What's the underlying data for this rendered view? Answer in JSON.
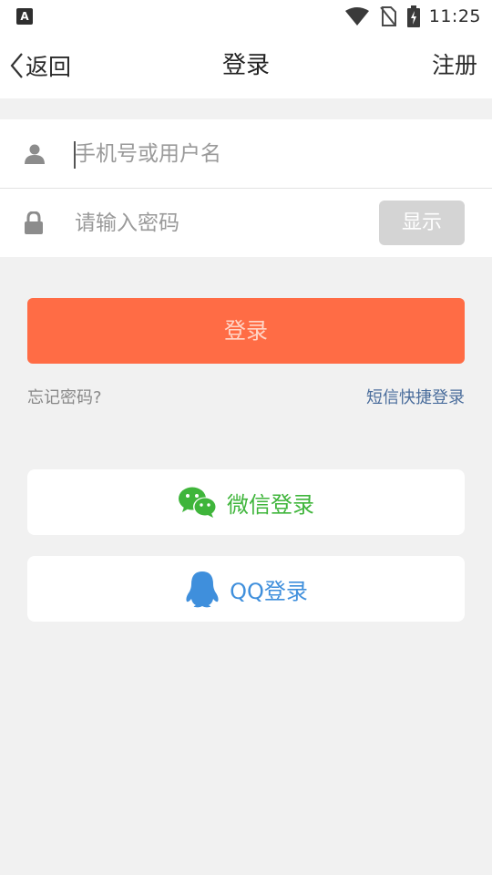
{
  "status_bar": {
    "app_icon_letter": "A",
    "time": "11:25",
    "icons": [
      "app-notification-icon",
      "wifi-icon",
      "no-sim-icon",
      "battery-charging-icon"
    ]
  },
  "nav": {
    "back_label": "返回",
    "title": "登录",
    "register_label": "注册"
  },
  "form": {
    "username": {
      "value": "",
      "placeholder": "手机号或用户名",
      "icon": "user-icon"
    },
    "password": {
      "value": "",
      "placeholder": "请输入密码",
      "icon": "lock-icon"
    },
    "show_label": "显示"
  },
  "login_button_label": "登录",
  "links": {
    "forgot": "忘记密码?",
    "sms_login": "短信快捷登录"
  },
  "social": {
    "wechat_label": "微信登录",
    "qq_label": "QQ登录"
  },
  "colors": {
    "accent": "#ff6c45",
    "wechat": "#3fb53b",
    "qq": "#3f8fdc",
    "link": "#4a6d9c",
    "background": "#f1f1f1"
  }
}
